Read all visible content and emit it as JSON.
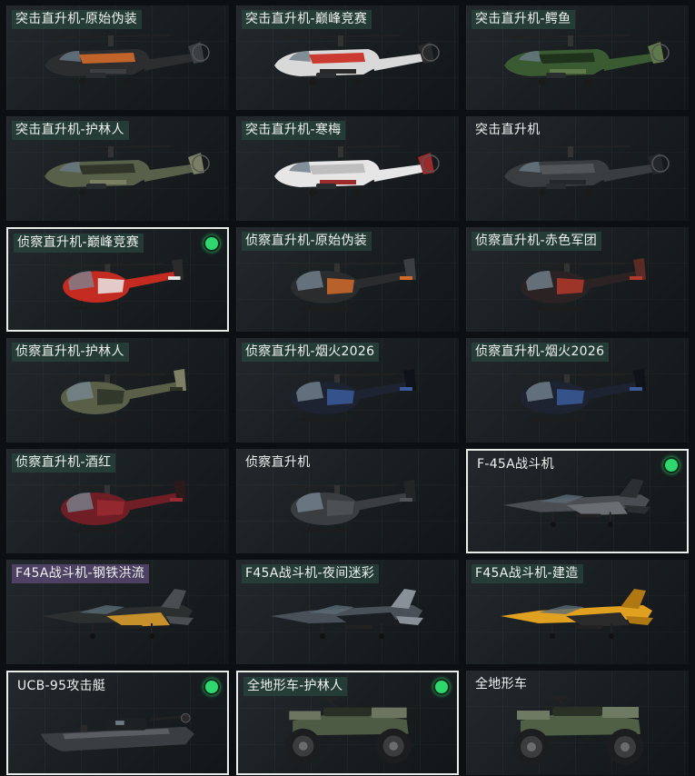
{
  "cards": [
    {
      "label": "突击直升机-原始伪装",
      "type": "attack_heli",
      "selected": false,
      "equipped": false,
      "tag": "green",
      "colors": {
        "body": "#2b2d2f",
        "accent": "#d06a2a",
        "accent2": "#3b3f42"
      }
    },
    {
      "label": "突击直升机-巅峰竞赛",
      "type": "attack_heli",
      "selected": false,
      "equipped": false,
      "tag": "green",
      "colors": {
        "body": "#d9d9d9",
        "accent": "#c8281e",
        "accent2": "#2a2a2a"
      }
    },
    {
      "label": "突击直升机-鳄鱼",
      "type": "attack_heli",
      "selected": false,
      "equipped": false,
      "tag": "green",
      "colors": {
        "body": "#3a5a32",
        "accent": "#1c2e1a",
        "accent2": "#5f7a4a"
      }
    },
    {
      "label": "突击直升机-护林人",
      "type": "attack_heli",
      "selected": false,
      "equipped": false,
      "tag": "green",
      "colors": {
        "body": "#59604a",
        "accent": "#2c3126",
        "accent2": "#7a7f64"
      }
    },
    {
      "label": "突击直升机-寒梅",
      "type": "attack_heli",
      "selected": false,
      "equipped": false,
      "tag": "green",
      "colors": {
        "body": "#e6e6e6",
        "accent": "#b9b9b9",
        "accent2": "#9b2a2a"
      }
    },
    {
      "label": "突击直升机",
      "type": "attack_heli",
      "selected": false,
      "equipped": false,
      "tag": "none",
      "colors": {
        "body": "#3a3d40",
        "accent": "#55595c",
        "accent2": "#25282a"
      }
    },
    {
      "label": "侦察直升机-巅峰竞赛",
      "type": "scout_heli",
      "selected": true,
      "equipped": true,
      "tag": "green",
      "colors": {
        "body": "#c42b20",
        "accent": "#e8e8e8",
        "accent2": "#2a2a2a"
      }
    },
    {
      "label": "侦察直升机-原始伪装",
      "type": "scout_heli",
      "selected": false,
      "equipped": false,
      "tag": "green",
      "colors": {
        "body": "#2a2c2e",
        "accent": "#d26b2a",
        "accent2": "#3c3f42"
      }
    },
    {
      "label": "侦察直升机-赤色军团",
      "type": "scout_heli",
      "selected": false,
      "equipped": false,
      "tag": "green",
      "colors": {
        "body": "#2a2223",
        "accent": "#b23a2a",
        "accent2": "#5a2a24"
      }
    },
    {
      "label": "侦察直升机-护林人",
      "type": "scout_heli",
      "selected": false,
      "equipped": false,
      "tag": "green",
      "colors": {
        "body": "#5a6048",
        "accent": "#2d3226",
        "accent2": "#7d8064"
      }
    },
    {
      "label": "侦察直升机-烟火2026",
      "type": "scout_heli",
      "selected": false,
      "equipped": false,
      "tag": "green",
      "colors": {
        "body": "#1d2330",
        "accent": "#3a5a9a",
        "accent2": "#0f1218"
      }
    },
    {
      "label": "侦察直升机-烟火2026",
      "type": "scout_heli",
      "selected": false,
      "equipped": false,
      "tag": "green",
      "colors": {
        "body": "#1d2330",
        "accent": "#3a5a9a",
        "accent2": "#0f1218"
      }
    },
    {
      "label": "侦察直升机-酒红",
      "type": "scout_heli",
      "selected": false,
      "equipped": false,
      "tag": "green",
      "colors": {
        "body": "#6e1e24",
        "accent": "#9a2a30",
        "accent2": "#2a1a1c"
      }
    },
    {
      "label": "侦察直升机",
      "type": "scout_heli",
      "selected": false,
      "equipped": false,
      "tag": "none",
      "colors": {
        "body": "#3b3e41",
        "accent": "#505457",
        "accent2": "#222426"
      }
    },
    {
      "label": "F-45A战斗机",
      "type": "jet",
      "selected": true,
      "equipped": true,
      "tag": "none",
      "colors": {
        "body": "#4a4e52",
        "accent": "#6a6e72",
        "accent2": "#2c2f32"
      }
    },
    {
      "label": "F45A战斗机-钢铁洪流",
      "type": "jet",
      "selected": false,
      "equipped": false,
      "tag": "purple",
      "colors": {
        "body": "#2c2f30",
        "accent": "#c8902a",
        "accent2": "#4a4e50"
      }
    },
    {
      "label": "F45A战斗机-夜间迷彩",
      "type": "jet",
      "selected": false,
      "equipped": false,
      "tag": "green",
      "colors": {
        "body": "#4a5058",
        "accent": "#1a1d22",
        "accent2": "#8a9098"
      }
    },
    {
      "label": "F45A战斗机-建造",
      "type": "jet",
      "selected": false,
      "equipped": false,
      "tag": "green",
      "colors": {
        "body": "#e0a020",
        "accent": "#2a2a2a",
        "accent2": "#b07812"
      }
    },
    {
      "label": "UCB-95攻击艇",
      "type": "boat",
      "selected": true,
      "equipped": true,
      "tag": "none",
      "colors": {
        "body": "#3a3e42",
        "accent": "#5a5e62",
        "accent2": "#1e2124"
      }
    },
    {
      "label": "全地形车-护林人",
      "type": "atv",
      "selected": true,
      "equipped": true,
      "tag": "green",
      "colors": {
        "body": "#4d5a44",
        "accent": "#2a2f26",
        "accent2": "#6b7560"
      }
    },
    {
      "label": "全地形车",
      "type": "atv",
      "selected": false,
      "equipped": false,
      "tag": "none",
      "colors": {
        "body": "#4f6044",
        "accent": "#2a3024",
        "accent2": "#6e7a62"
      }
    }
  ]
}
